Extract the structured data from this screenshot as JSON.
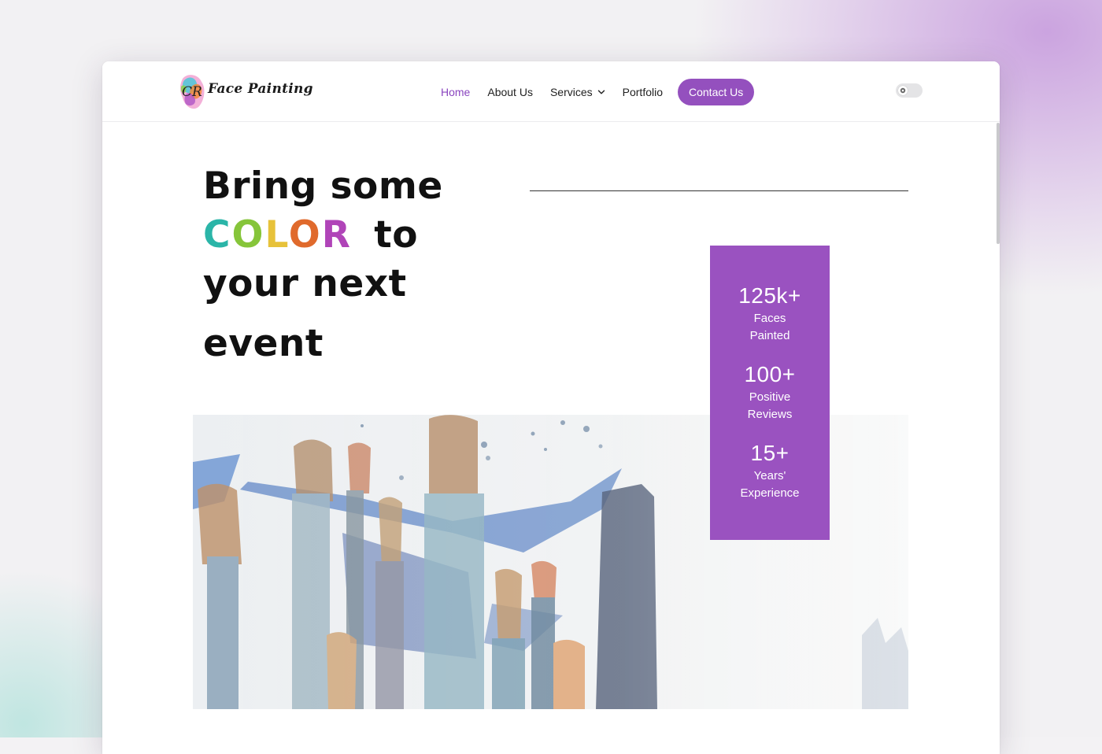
{
  "brand": {
    "name": "Face Painting",
    "initials": "CR"
  },
  "nav": {
    "items": [
      {
        "label": "Home",
        "active": true
      },
      {
        "label": "About Us"
      },
      {
        "label": "Services",
        "has_dropdown": true
      },
      {
        "label": "Portfolio"
      }
    ],
    "cta_label": "Contact Us"
  },
  "theme_toggle": {
    "state": "off"
  },
  "hero": {
    "line1": "Bring some",
    "color_word": [
      "C",
      "O",
      "L",
      "O",
      "R"
    ],
    "after_color": "to",
    "line3": "your next",
    "line4": "event"
  },
  "stats": [
    {
      "value": "125k+",
      "label_line1": "Faces",
      "label_line2": "Painted"
    },
    {
      "value": "100+",
      "label_line1": "Positive",
      "label_line2": "Reviews"
    },
    {
      "value": "15+",
      "label_line1": "Years'",
      "label_line2": "Experience"
    }
  ],
  "colors": {
    "accent": "#9a52c0",
    "nav_active": "#8a45bf",
    "color_letters": [
      "#2bb5a8",
      "#86c53a",
      "#e7c23a",
      "#e06a2c",
      "#b044b8"
    ]
  },
  "icons": {
    "services_dropdown": "chevron-down-icon",
    "theme_toggle": "gear-icon"
  }
}
